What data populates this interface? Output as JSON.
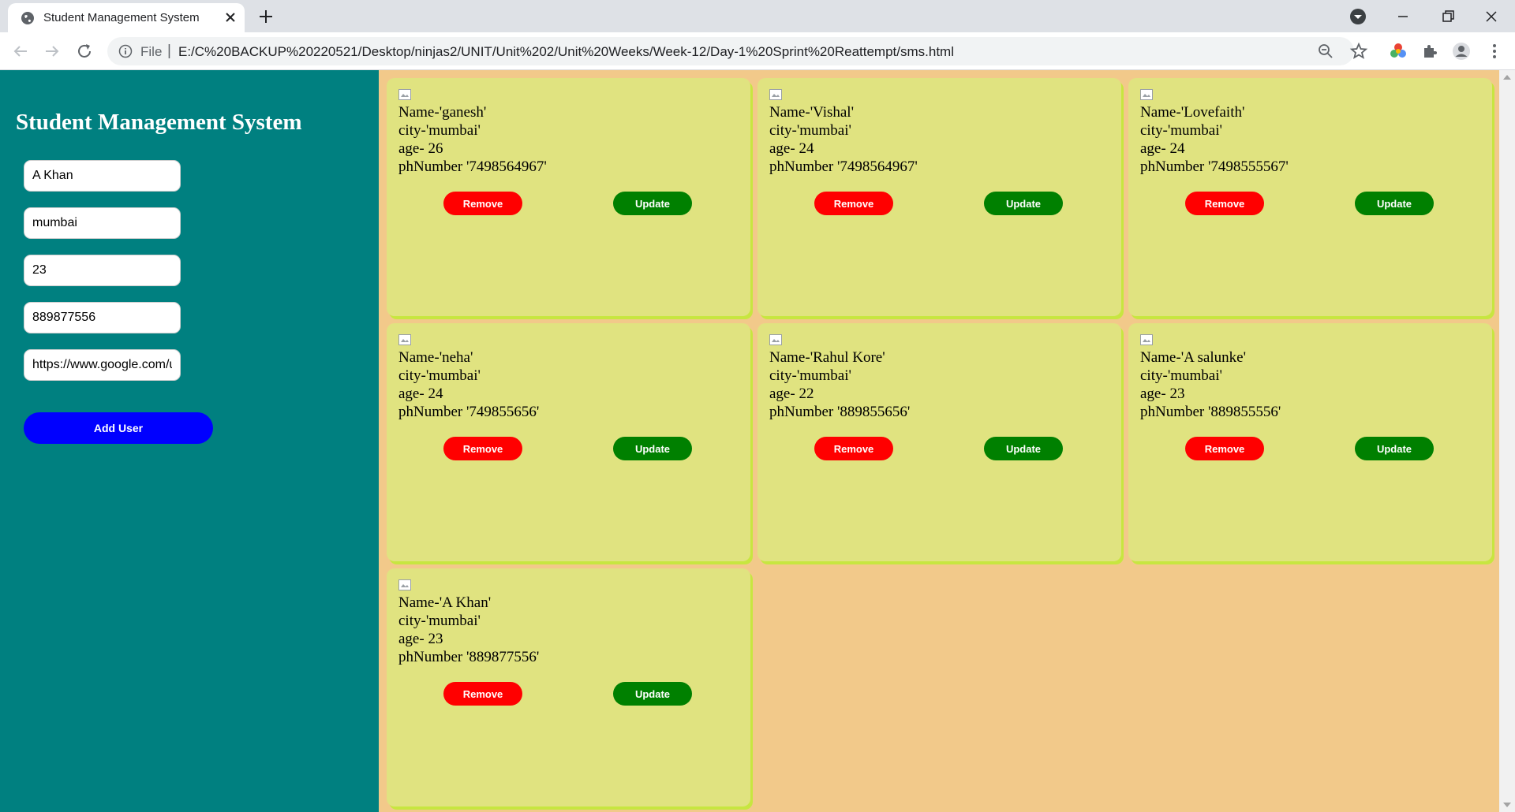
{
  "browser": {
    "tab_title": "Student Management System",
    "scheme_label": "File",
    "url": "E:/C%20BACKUP%20220521/Desktop/ninjas2/UNIT/Unit%202/Unit%20Weeks/Week-12/Day-1%20Sprint%20Reattempt/sms.html"
  },
  "sidebar": {
    "title": "Student Management System",
    "fields": {
      "name": "A Khan",
      "city": "mumbai",
      "age": "23",
      "phone": "889877556",
      "image_url": "https://www.google.com/url"
    },
    "add_button_label": "Add User"
  },
  "cards": [
    {
      "name": "Name-'ganesh'",
      "city": "city-'mumbai'",
      "age": "age- 26",
      "phone": "phNumber '7498564967'",
      "remove_label": "Remove",
      "update_label": "Update"
    },
    {
      "name": "Name-'Vishal'",
      "city": "city-'mumbai'",
      "age": "age- 24",
      "phone": "phNumber '7498564967'",
      "remove_label": "Remove",
      "update_label": "Update"
    },
    {
      "name": "Name-'Lovefaith'",
      "city": "city-'mumbai'",
      "age": "age- 24",
      "phone": "phNumber '7498555567'",
      "remove_label": "Remove",
      "update_label": "Update"
    },
    {
      "name": "Name-'neha'",
      "city": "city-'mumbai'",
      "age": "age- 24",
      "phone": "phNumber '749855656'",
      "remove_label": "Remove",
      "update_label": "Update"
    },
    {
      "name": "Name-'Rahul Kore'",
      "city": "city-'mumbai'",
      "age": "age- 22",
      "phone": "phNumber '889855656'",
      "remove_label": "Remove",
      "update_label": "Update"
    },
    {
      "name": "Name-'A salunke'",
      "city": "city-'mumbai'",
      "age": "age- 23",
      "phone": "phNumber '889855556'",
      "remove_label": "Remove",
      "update_label": "Update"
    },
    {
      "name": "Name-'A Khan'",
      "city": "city-'mumbai'",
      "age": "age- 23",
      "phone": "phNumber '889877556'",
      "remove_label": "Remove",
      "update_label": "Update"
    }
  ],
  "colors": {
    "sidebar_bg": "#008080",
    "main_bg": "#f2c98a",
    "card_bg": "#e0e380",
    "card_shadow": "#c7e640",
    "remove_button": "#ff0000",
    "update_button": "#008000",
    "add_button": "#0000ff"
  },
  "icons": [
    "globe-favicon",
    "close-icon",
    "plus-icon",
    "back-arrow-icon",
    "forward-arrow-icon",
    "reload-icon",
    "info-icon",
    "zoom-icon",
    "star-icon",
    "color-wheel-icon",
    "puzzle-icon",
    "account-icon",
    "menu-dots-icon",
    "minimize-icon",
    "restore-icon",
    "window-close-icon",
    "broken-image-icon"
  ]
}
